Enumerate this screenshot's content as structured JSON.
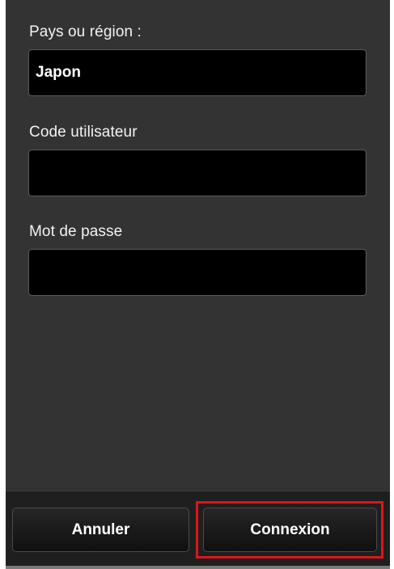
{
  "form": {
    "country": {
      "label": "Pays ou région :",
      "value": "Japon"
    },
    "user_id": {
      "label": "Code utilisateur",
      "value": ""
    },
    "password": {
      "label": "Mot de passe",
      "value": ""
    }
  },
  "footer": {
    "cancel_label": "Annuler",
    "login_label": "Connexion"
  },
  "colors": {
    "background": "#333333",
    "field_background": "#000000",
    "footer_background": "#1f1f1f",
    "highlight": "#e0141b",
    "text": "#ffffff"
  }
}
